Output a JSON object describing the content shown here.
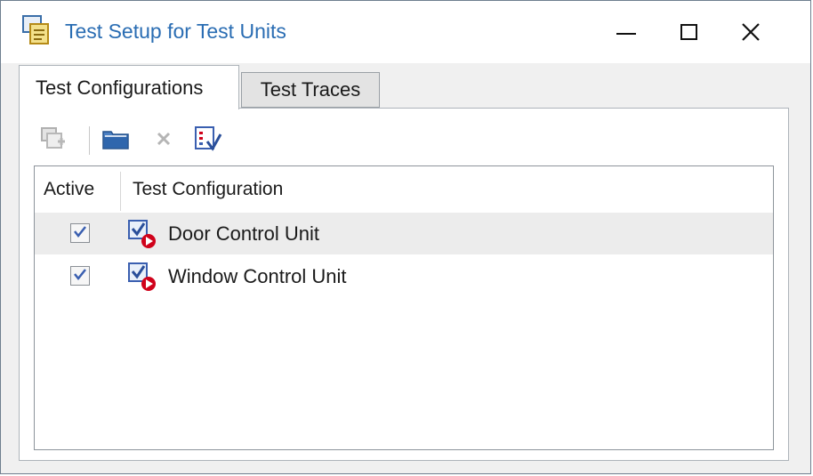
{
  "window": {
    "title": "Test Setup for Test Units",
    "icon": "test-setup-icon",
    "controls": [
      "minimize-icon",
      "maximize-icon",
      "close-icon"
    ]
  },
  "tabs": [
    {
      "label": "Test Configurations",
      "active": true
    },
    {
      "label": "Test Traces",
      "active": false
    }
  ],
  "toolbar": {
    "buttons": [
      {
        "icon": "add-configuration-icon",
        "enabled": false
      },
      {
        "icon": "open-folder-icon",
        "enabled": true
      },
      {
        "icon": "delete-icon",
        "enabled": false
      },
      {
        "icon": "check-list-icon",
        "enabled": true
      }
    ]
  },
  "grid": {
    "columns": [
      "Active",
      "Test Configuration"
    ],
    "rows": [
      {
        "active": true,
        "icon": "test-configuration-icon",
        "name": "Door Control Unit",
        "selected": true
      },
      {
        "active": true,
        "icon": "test-configuration-icon",
        "name": "Window Control Unit",
        "selected": false
      }
    ]
  },
  "colors": {
    "title": "#2a6db3",
    "checkmark": "#3a5fb0",
    "status_red": "#d0021b",
    "selected_row": "#ececec"
  }
}
